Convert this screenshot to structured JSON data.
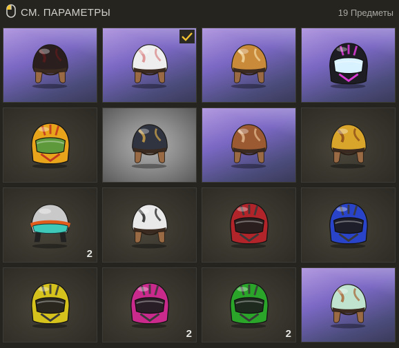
{
  "header": {
    "title": "СМ. ПАРАМЕТРЫ",
    "count_label": "19 Предметы",
    "icon": "mouse-icon"
  },
  "items": [
    {
      "kind": "open",
      "bg": "purple",
      "c1": "#2a1e1e",
      "c2": "#5b1c1c",
      "visor": "",
      "qty": "",
      "selected": false
    },
    {
      "kind": "open",
      "bg": "purple",
      "c1": "#eeeeee",
      "c2": "#d98a8a",
      "visor": "",
      "qty": "",
      "selected": true
    },
    {
      "kind": "open",
      "bg": "purple",
      "c1": "#c98a3a",
      "c2": "#f0d39a",
      "visor": "",
      "qty": "",
      "selected": false
    },
    {
      "kind": "full",
      "bg": "purple",
      "c1": "#1d1d23",
      "c2": "#d63ad0",
      "visor": "#d8f2ff",
      "qty": "",
      "selected": false
    },
    {
      "kind": "full",
      "bg": "dark",
      "c1": "#e8a51c",
      "c2": "#c23a1f",
      "visor": "#5e9a3b",
      "qty": "",
      "selected": false
    },
    {
      "kind": "open",
      "bg": "grey",
      "c1": "#2f3440",
      "c2": "#c9a04a",
      "visor": "",
      "qty": "",
      "selected": false
    },
    {
      "kind": "open",
      "bg": "purple",
      "c1": "#9b5a32",
      "c2": "#e0b58a",
      "visor": "",
      "qty": "",
      "selected": false
    },
    {
      "kind": "open",
      "bg": "dark",
      "c1": "#d9a52a",
      "c2": "#8a4a1a",
      "visor": "",
      "qty": "",
      "selected": false
    },
    {
      "kind": "goggle",
      "bg": "dark",
      "c1": "#c9c9c9",
      "c2": "#e25c1c",
      "visor": "#3ec9b9",
      "qty": "2",
      "selected": false
    },
    {
      "kind": "open",
      "bg": "dark",
      "c1": "#e9e9e9",
      "c2": "#222222",
      "visor": "",
      "qty": "",
      "selected": false
    },
    {
      "kind": "full",
      "bg": "dark",
      "c1": "#b0242a",
      "c2": "#3a3a3a",
      "visor": "#2a1e1e",
      "qty": "",
      "selected": false
    },
    {
      "kind": "full",
      "bg": "dark",
      "c1": "#2a44c9",
      "c2": "#3a3a3a",
      "visor": "#1e1e2a",
      "qty": "",
      "selected": false
    },
    {
      "kind": "full",
      "bg": "dark",
      "c1": "#d6c21c",
      "c2": "#3a3a3a",
      "visor": "#2a271e",
      "qty": "",
      "selected": false
    },
    {
      "kind": "full",
      "bg": "dark",
      "c1": "#c92a8c",
      "c2": "#3a3a3a",
      "visor": "#2a1e26",
      "qty": "2",
      "selected": false
    },
    {
      "kind": "full",
      "bg": "dark",
      "c1": "#2aa52a",
      "c2": "#3a3a3a",
      "visor": "#1e2a1e",
      "qty": "2",
      "selected": false
    },
    {
      "kind": "open",
      "bg": "purple",
      "c1": "#bfe3cf",
      "c2": "#a86a3a",
      "visor": "",
      "qty": "",
      "selected": false
    }
  ]
}
